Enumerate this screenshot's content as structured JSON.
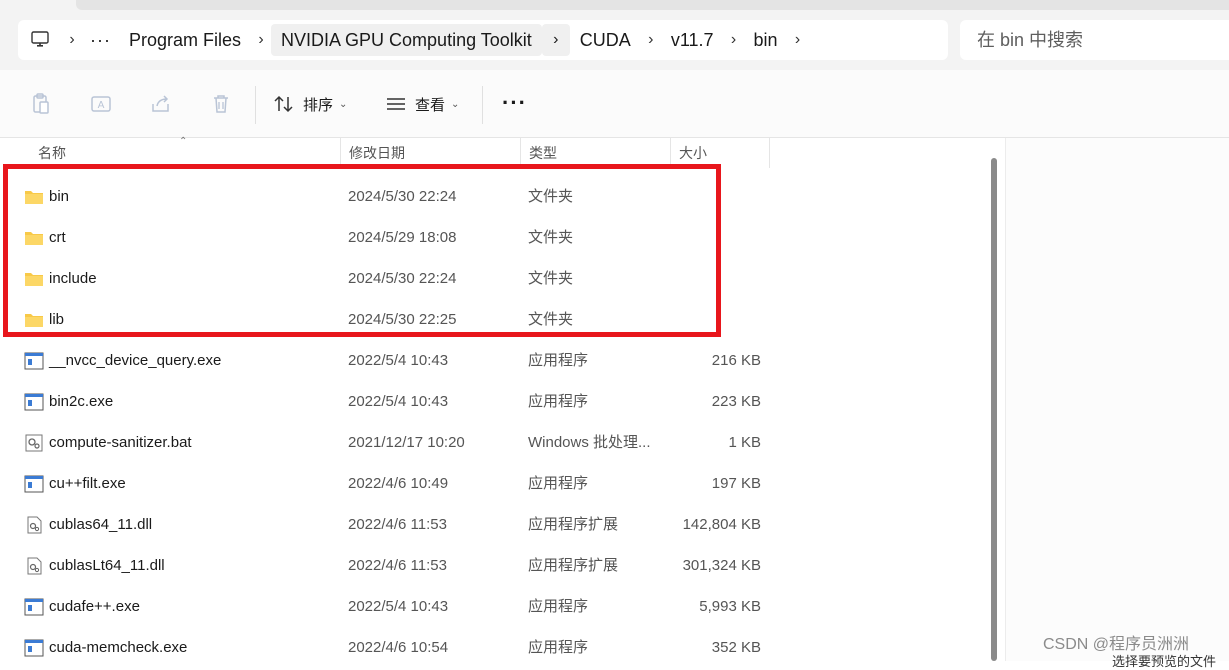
{
  "breadcrumb": {
    "more": "···",
    "items": [
      "Program Files",
      "NVIDIA GPU Computing Toolkit",
      "CUDA",
      "v11.7",
      "bin"
    ]
  },
  "search": {
    "placeholder": "在 bin 中搜索"
  },
  "toolbar": {
    "sort_label": "排序",
    "view_label": "查看",
    "more_label": "···",
    "icons": [
      "paste-icon",
      "rename-icon",
      "share-icon",
      "delete-icon",
      "sort-icon",
      "view-icon"
    ]
  },
  "columns": {
    "name": "名称",
    "date": "修改日期",
    "type": "类型",
    "size": "大小"
  },
  "files": [
    {
      "icon": "folder-icon",
      "name": "bin",
      "date": "2024/5/30 22:24",
      "type": "文件夹",
      "size": ""
    },
    {
      "icon": "folder-icon",
      "name": "crt",
      "date": "2024/5/29 18:08",
      "type": "文件夹",
      "size": ""
    },
    {
      "icon": "folder-icon",
      "name": "include",
      "date": "2024/5/30 22:24",
      "type": "文件夹",
      "size": ""
    },
    {
      "icon": "folder-icon",
      "name": "lib",
      "date": "2024/5/30 22:25",
      "type": "文件夹",
      "size": ""
    },
    {
      "icon": "exe-icon",
      "name": "__nvcc_device_query.exe",
      "date": "2022/5/4 10:43",
      "type": "应用程序",
      "size": "216 KB"
    },
    {
      "icon": "exe-icon",
      "name": "bin2c.exe",
      "date": "2022/5/4 10:43",
      "type": "应用程序",
      "size": "223 KB"
    },
    {
      "icon": "bat-icon",
      "name": "compute-sanitizer.bat",
      "date": "2021/12/17 10:20",
      "type": "Windows 批处理...",
      "size": "1 KB"
    },
    {
      "icon": "exe-icon",
      "name": "cu++filt.exe",
      "date": "2022/4/6 10:49",
      "type": "应用程序",
      "size": "197 KB"
    },
    {
      "icon": "dll-icon",
      "name": "cublas64_11.dll",
      "date": "2022/4/6 11:53",
      "type": "应用程序扩展",
      "size": "142,804 KB"
    },
    {
      "icon": "dll-icon",
      "name": "cublasLt64_11.dll",
      "date": "2022/4/6 11:53",
      "type": "应用程序扩展",
      "size": "301,324 KB"
    },
    {
      "icon": "exe-icon",
      "name": "cudafe++.exe",
      "date": "2022/5/4 10:43",
      "type": "应用程序",
      "size": "5,993 KB"
    },
    {
      "icon": "exe-icon",
      "name": "cuda-memcheck.exe",
      "date": "2022/4/6 10:54",
      "type": "应用程序",
      "size": "352 KB"
    }
  ],
  "highlight_color": "#e8161c",
  "watermark": "CSDN @程序员洲洲",
  "preview_cutoff_text": "选择要预览的文件"
}
